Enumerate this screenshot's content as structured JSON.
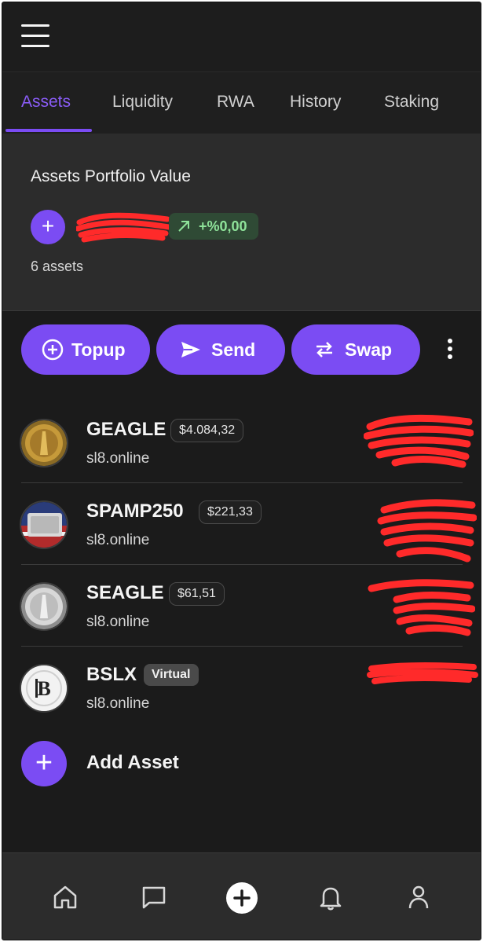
{
  "colors": {
    "accent": "#7b4cf3",
    "background": "#1b1b1b",
    "card": "#2c2c2c",
    "positive": "#8fe39a"
  },
  "header": {
    "menu_icon": "hamburger-menu-icon"
  },
  "tabs": [
    {
      "label": "Assets",
      "active": true
    },
    {
      "label": "Liquidity",
      "active": false
    },
    {
      "label": "RWA",
      "active": false
    },
    {
      "label": "History",
      "active": false
    },
    {
      "label": "Staking",
      "active": false
    }
  ],
  "portfolio": {
    "title": "Assets Portfolio Value",
    "change": "+%0,00",
    "count_label": "6 assets"
  },
  "actions": {
    "topup": "Topup",
    "send": "Send",
    "swap": "Swap",
    "more_icon": "more-vertical-icon"
  },
  "assets": [
    {
      "name": "GEAGLE",
      "price": "$4.084,32",
      "domain": "sl8.online"
    },
    {
      "name": "SPAMP250",
      "price": "$221,33",
      "domain": "sl8.online"
    },
    {
      "name": "SEAGLE",
      "price": "$61,51",
      "domain": "sl8.online"
    },
    {
      "name": "BSLX",
      "badge": "Virtual",
      "domain": "sl8.online"
    }
  ],
  "add_asset": {
    "label": "Add Asset"
  },
  "bottom_nav": {
    "items": [
      "home-icon",
      "chat-icon",
      "add-circle-icon",
      "bell-icon",
      "profile-icon"
    ]
  }
}
